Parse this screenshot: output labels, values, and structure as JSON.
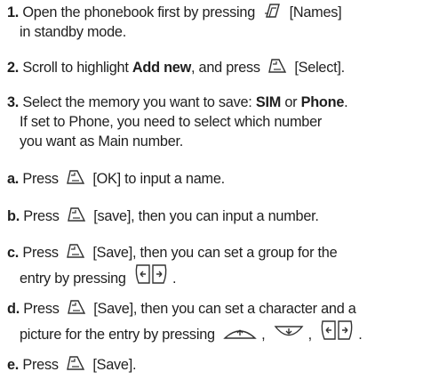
{
  "steps": [
    {
      "num": "1.",
      "t1": "Open the phonebook first by pressing",
      "t2": "[Names]",
      "l2": "in standby mode."
    },
    {
      "num": "2.",
      "t1": "Scroll to highlight",
      "b1": "Add new",
      "t2": ", and press",
      "t3": "[Select]."
    },
    {
      "num": "3.",
      "t1": "Select the memory you want to save:",
      "b1": "SIM",
      "t2": "or",
      "b2": "Phone",
      "t3": ".",
      "l2": "If set to Phone, you need to select which number",
      "l3": "you want as Main number."
    },
    {
      "num": "a.",
      "t1": "Press",
      "t2": "[OK] to input a name."
    },
    {
      "num": "b.",
      "t1": "Press",
      "t2": "[save], then you can input a number."
    },
    {
      "num": "c.",
      "t1": "Press",
      "t2": "[Save], then you can set a group for the",
      "l2": "entry by pressing",
      "l2end": "."
    },
    {
      "num": "d.",
      "t1": "Press",
      "t2": "[Save], then you can set a character and a",
      "l2": "picture for the entry by pressing",
      "sep1": ",",
      "sep2": ",",
      "l2end": "."
    },
    {
      "num": "e.",
      "t1": "Press",
      "t2": "[Save]."
    }
  ]
}
